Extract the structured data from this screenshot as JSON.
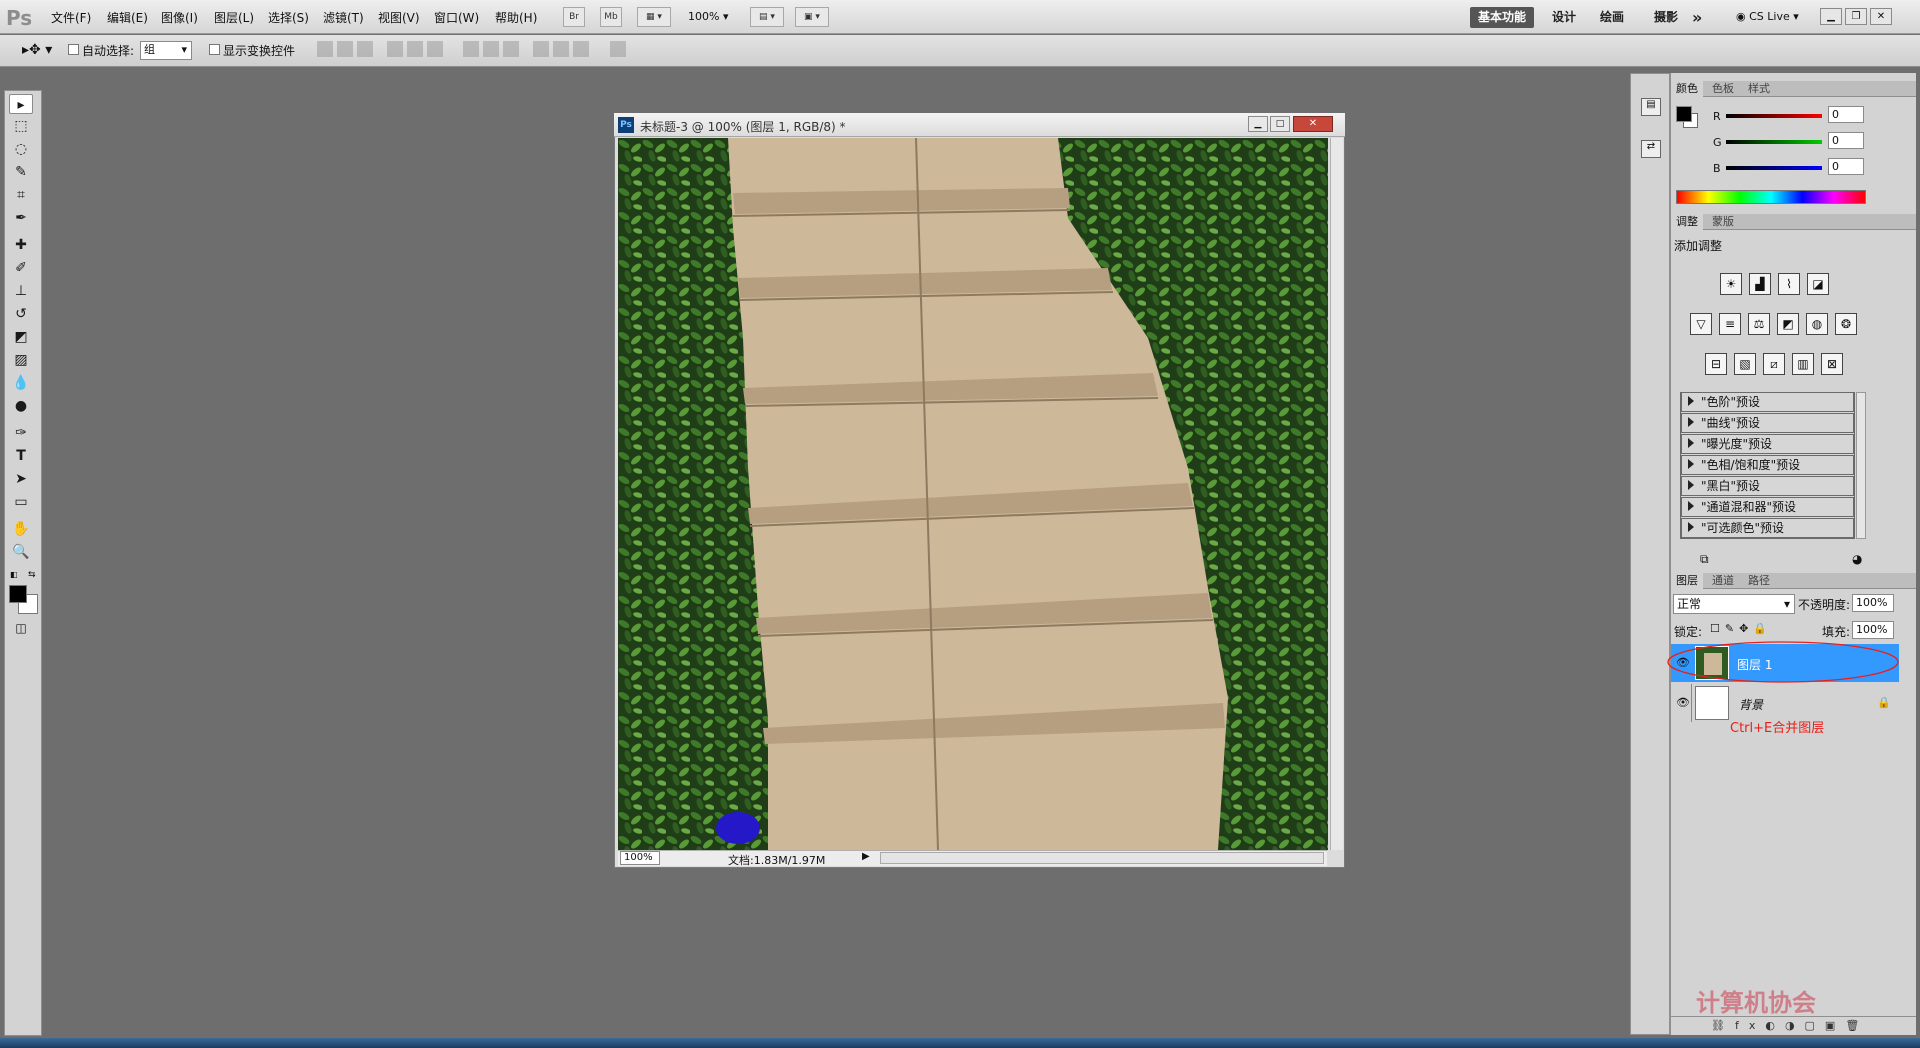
{
  "app": {
    "logo": "Ps",
    "menus": [
      "文件(F)",
      "编辑(E)",
      "图像(I)",
      "图层(L)",
      "选择(S)",
      "滤镜(T)",
      "视图(V)",
      "窗口(W)",
      "帮助(H)"
    ],
    "bridge_btn": "Br",
    "mini_btn": "Mb",
    "zoom_menu": "100%",
    "workspaces": [
      "基本功能",
      "设计",
      "绘画",
      "摄影"
    ],
    "more": "»",
    "cs_live": "CS Live"
  },
  "options": {
    "auto_select_label": "自动选择:",
    "auto_select_value": "组",
    "show_transform_label": "显示变换控件"
  },
  "document": {
    "title": "未标题-3 @ 100% (图层 1, RGB/8) *",
    "zoom": "100%",
    "doc_info": "文档:1.83M/1.97M"
  },
  "color_panel": {
    "tabs": [
      "颜色",
      "色板",
      "样式"
    ],
    "channels": [
      {
        "name": "R",
        "value": "0"
      },
      {
        "name": "G",
        "value": "0"
      },
      {
        "name": "B",
        "value": "0"
      }
    ]
  },
  "adjust_panel": {
    "tabs": [
      "调整",
      "蒙版"
    ],
    "heading": "添加调整",
    "presets": [
      "\"色阶\"预设",
      "\"曲线\"预设",
      "\"曝光度\"预设",
      "\"色相/饱和度\"预设",
      "\"黑白\"预设",
      "\"通道混和器\"预设",
      "\"可选颜色\"预设"
    ]
  },
  "layers_panel": {
    "tabs": [
      "图层",
      "通道",
      "路径"
    ],
    "blend_mode": "正常",
    "opacity_label": "不透明度:",
    "opacity": "100%",
    "lock_label": "锁定:",
    "fill_label": "填充:",
    "fill": "100%",
    "layers": [
      {
        "name": "图层 1",
        "selected": true
      },
      {
        "name": "背景",
        "selected": false
      }
    ],
    "annotation": "Ctrl+E合并图层"
  },
  "watermark": "计算机协会",
  "colors": {
    "accent": "#3399ff",
    "annotation": "#e8201b"
  }
}
